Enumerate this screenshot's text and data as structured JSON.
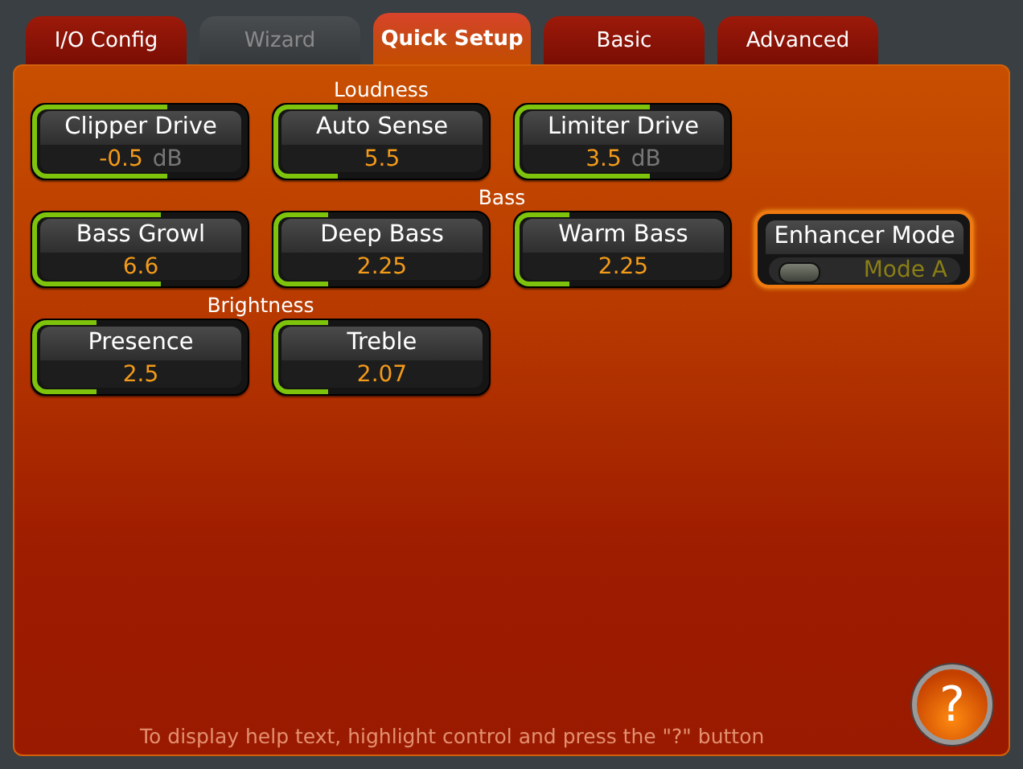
{
  "tabs": [
    {
      "label": "I/O Config",
      "selected": false,
      "disabled": false
    },
    {
      "label": "Wizard",
      "selected": false,
      "disabled": true
    },
    {
      "label": "Quick Setup",
      "selected": true,
      "disabled": false
    },
    {
      "label": "Basic",
      "selected": false,
      "disabled": false
    },
    {
      "label": "Advanced",
      "selected": false,
      "disabled": false
    }
  ],
  "groups": [
    {
      "title": "Loudness",
      "controls": [
        {
          "kind": "knob",
          "label": "Clipper Drive",
          "value": "-0.5",
          "unit": "dB",
          "level": 0.63
        },
        {
          "kind": "knob",
          "label": "Auto Sense",
          "value": "5.5",
          "level": 0.3
        },
        {
          "kind": "knob",
          "label": "Limiter Drive",
          "value": "3.5",
          "unit": "dB",
          "level": 0.63
        }
      ]
    },
    {
      "title": "Bass",
      "controls": [
        {
          "kind": "knob",
          "label": "Bass Growl",
          "value": "6.6",
          "level": 0.6
        },
        {
          "kind": "knob",
          "label": "Deep Bass",
          "value": "2.25",
          "level": 0.25
        },
        {
          "kind": "knob",
          "label": "Warm Bass",
          "value": "2.25",
          "level": 0.25
        },
        {
          "kind": "switch",
          "label": "Enhancer Mode",
          "value": "Mode A",
          "on": false
        }
      ]
    },
    {
      "title": "Brightness",
      "controls": [
        {
          "kind": "knob",
          "label": "Presence",
          "value": "2.5",
          "level": 0.3
        },
        {
          "kind": "knob",
          "label": "Treble",
          "value": "2.07",
          "level": 0.25
        }
      ]
    }
  ],
  "help": {
    "hint": "To display help text, highlight control and press the \"?\" button",
    "button": "?"
  }
}
